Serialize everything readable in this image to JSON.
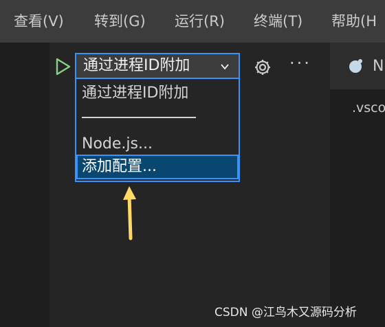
{
  "menubar": {
    "items": [
      {
        "label": "查看(V)"
      },
      {
        "label": "转到(G)"
      },
      {
        "label": "运行(R)"
      },
      {
        "label": "终端(T)"
      },
      {
        "label": "帮助(H"
      }
    ]
  },
  "debug_toolbar": {
    "run_icon": "play-icon",
    "config_selected": "通过进程ID附加",
    "settings_icon": "gear-icon",
    "more_label": "···"
  },
  "dropdown": {
    "options": [
      {
        "label": "通过进程ID附加"
      },
      {
        "label": "Node.js..."
      },
      {
        "label": "添加配置..."
      }
    ],
    "selected_index": 2
  },
  "editor": {
    "tab_label": "N",
    "tab_icon": "node-file-icon",
    "text": ".vsco"
  },
  "annotation": {
    "arrow_color": "#ffd966"
  },
  "watermark": "CSDN @江鸟木又源码分析",
  "colors": {
    "accent": "#3794ff",
    "selected_bg": "#094771",
    "play": "#89d185"
  }
}
